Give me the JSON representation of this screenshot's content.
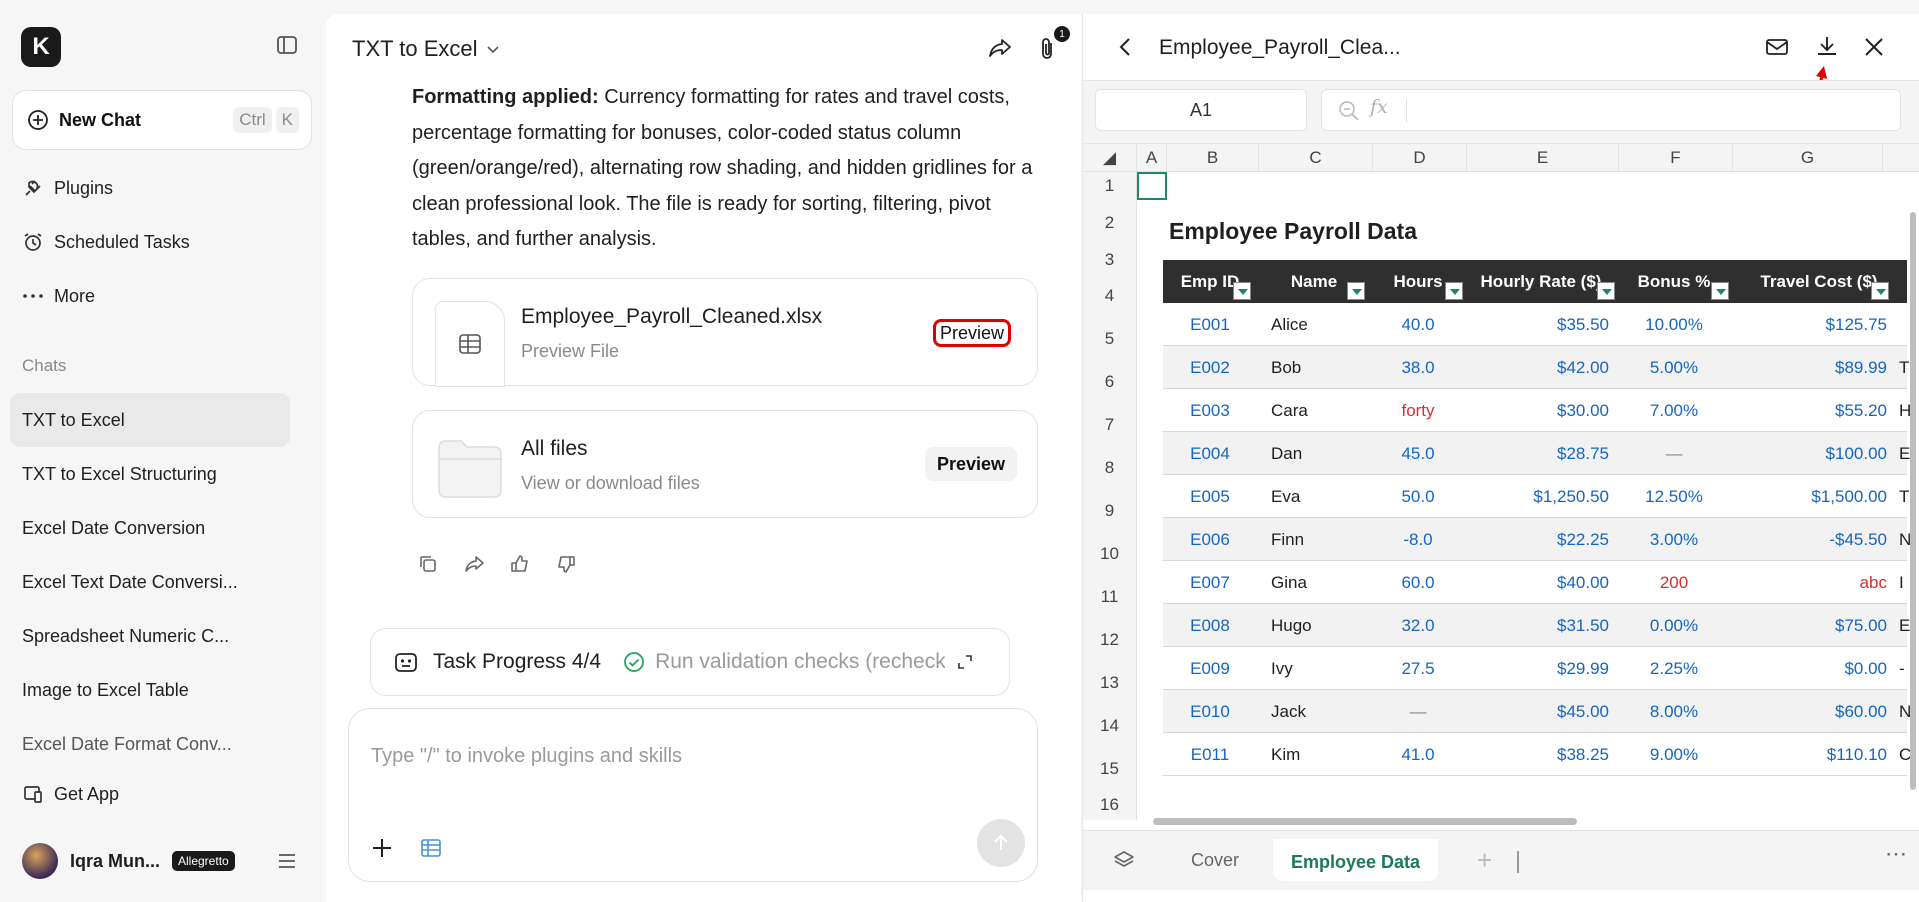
{
  "sidebar": {
    "new_chat": "New Chat",
    "shortcut": [
      "Ctrl",
      "K"
    ],
    "nav": [
      {
        "label": "Plugins",
        "icon": "plug-icon"
      },
      {
        "label": "Scheduled Tasks",
        "icon": "alarm-clock-icon"
      },
      {
        "label": "More",
        "icon": "more-dots-icon"
      }
    ],
    "chats_heading": "Chats",
    "chats": [
      "TXT to Excel",
      "TXT to Excel Structuring",
      "Excel Date Conversion",
      "Excel Text Date Conversi...",
      "Spreadsheet Numeric C...",
      "Image to Excel Table",
      "Excel Date Format Conv..."
    ],
    "get_app": "Get App",
    "user_name": "Iqra Mun...",
    "user_badge": "Allegretto"
  },
  "chat": {
    "title": "TXT to Excel",
    "clip_count": "1",
    "message_bold": "Formatting applied:",
    "message_text": " Currency formatting for rates and travel costs, percentage formatting for bonuses, color-coded status column (green/orange/red), alternating row shading, and hidden gridlines for a clean professional look. The file is ready for sorting, filtering, pivot tables, and further analysis.",
    "file_card": {
      "title": "Employee_Payroll_Cleaned.xlsx",
      "sub": "Preview File",
      "button": "Preview"
    },
    "folder_card": {
      "title": "All files",
      "sub": "View or download files",
      "button": "Preview"
    },
    "task_progress": "Task Progress 4/4",
    "task_step": "Run validation checks (recheck",
    "composer_placeholder": "Type \"/\" to invoke plugins and skills"
  },
  "preview": {
    "title": "Employee_Payroll_Clea...",
    "name_box": "A1",
    "fx_label": "fx",
    "columns": [
      "A",
      "B",
      "C",
      "D",
      "E",
      "F",
      "G"
    ],
    "rows": [
      "1",
      "2",
      "3",
      "4",
      "5",
      "6",
      "7",
      "8",
      "9",
      "10",
      "11",
      "12",
      "13",
      "14",
      "15",
      "16"
    ],
    "sheet_title": "Employee Payroll Data",
    "headers": [
      "Emp ID",
      "Name",
      "Hours",
      "Hourly Rate ($)",
      "Bonus %",
      "Travel Cost ($)"
    ],
    "data": [
      {
        "id": "E001",
        "name": "Alice",
        "hours": "40.0",
        "rate": "$35.50",
        "bonus": "10.00%",
        "travel": "$125.75",
        "extra": ""
      },
      {
        "id": "E002",
        "name": "Bob",
        "hours": "38.0",
        "rate": "$42.00",
        "bonus": "5.00%",
        "travel": "$89.99",
        "extra": "T"
      },
      {
        "id": "E003",
        "name": "Cara",
        "hours": "forty",
        "rate": "$30.00",
        "bonus": "7.00%",
        "travel": "$55.20",
        "extra": "H"
      },
      {
        "id": "E004",
        "name": "Dan",
        "hours": "45.0",
        "rate": "$28.75",
        "bonus": "—",
        "travel": "$100.00",
        "extra": "E"
      },
      {
        "id": "E005",
        "name": "Eva",
        "hours": "50.0",
        "rate": "$1,250.50",
        "bonus": "12.50%",
        "travel": "$1,500.00",
        "extra": "T"
      },
      {
        "id": "E006",
        "name": "Finn",
        "hours": "-8.0",
        "rate": "$22.25",
        "bonus": "3.00%",
        "travel": "-$45.50",
        "extra": "N"
      },
      {
        "id": "E007",
        "name": "Gina",
        "hours": "60.0",
        "rate": "$40.00",
        "bonus": "200",
        "travel": "abc",
        "extra": "I"
      },
      {
        "id": "E008",
        "name": "Hugo",
        "hours": "32.0",
        "rate": "$31.50",
        "bonus": "0.00%",
        "travel": "$75.00",
        "extra": "E"
      },
      {
        "id": "E009",
        "name": "Ivy",
        "hours": "27.5",
        "rate": "$29.99",
        "bonus": "2.25%",
        "travel": "$0.00",
        "extra": "-"
      },
      {
        "id": "E010",
        "name": "Jack",
        "hours": "—",
        "rate": "$45.00",
        "bonus": "8.00%",
        "travel": "$60.00",
        "extra": "N"
      },
      {
        "id": "E011",
        "name": "Kim",
        "hours": "41.0",
        "rate": "$38.25",
        "bonus": "9.00%",
        "travel": "$110.10",
        "extra": "C"
      }
    ],
    "sheet_tabs": [
      "Cover",
      "Employee Data"
    ],
    "active_tab": "Employee Data"
  },
  "colors": {
    "accent_green": "#1b7a5a",
    "highlight_red": "#e00000",
    "value_blue": "#1565c0",
    "value_red": "#d32f2f"
  }
}
